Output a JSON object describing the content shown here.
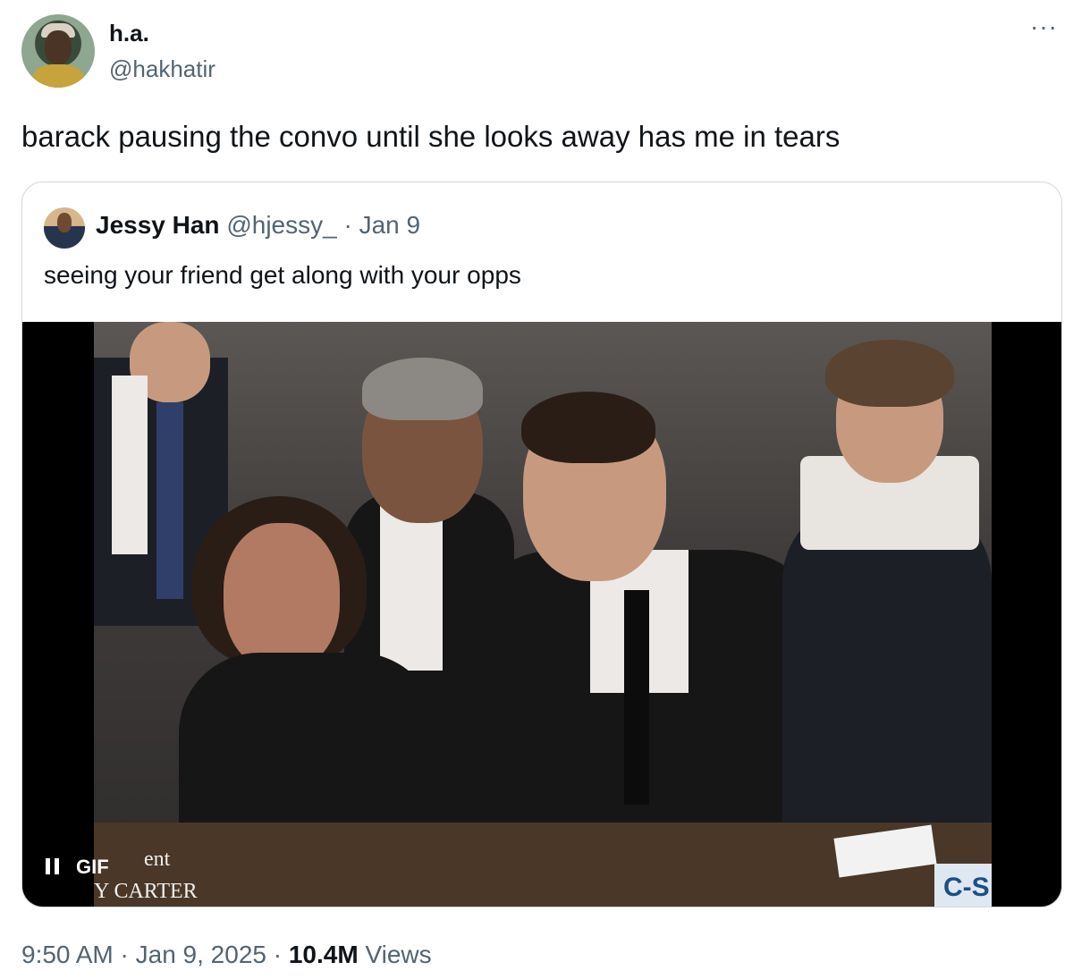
{
  "author": {
    "name": "h.a.",
    "handle": "@hakhatir"
  },
  "more_icon": "ellipsis-icon",
  "tweet": {
    "text": "barack pausing the convo until she looks away has me in tears"
  },
  "quoted": {
    "name": "Jessy Han",
    "handle": "@hjessy_",
    "separator": "·",
    "date": "Jan 9",
    "text": "seeing your friend get along with your opps",
    "media": {
      "gif_label": "GIF",
      "pause_icon": "pause-icon",
      "chyron_line1": "ent",
      "chyron_line2": "Y CARTER",
      "network_logo": "C-S"
    }
  },
  "meta": {
    "time": "9:50 AM",
    "sep1": "·",
    "date": "Jan 9, 2025",
    "sep2": "·",
    "views_count": "10.4M",
    "views_label": "Views"
  }
}
